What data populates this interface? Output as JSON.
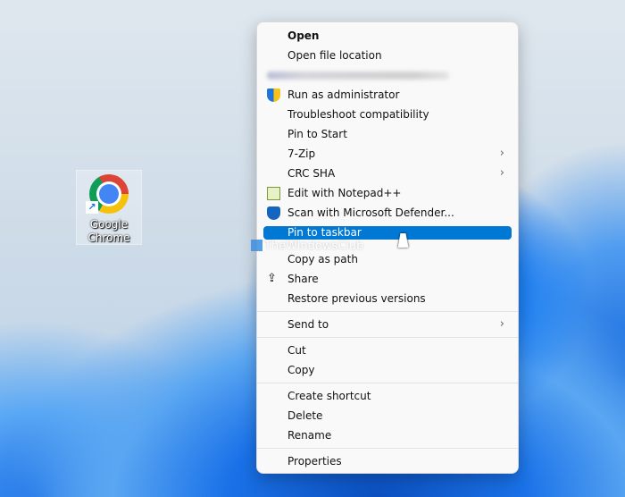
{
  "desktop": {
    "icon": {
      "label": "Google Chrome",
      "icon": "chrome-icon",
      "shortcut_overlay": "shortcut-arrow-icon"
    }
  },
  "menu": {
    "items": [
      {
        "label": "Open",
        "bold": true
      },
      {
        "label": "Open file location"
      },
      {
        "label": "",
        "blurred": true
      },
      {
        "label": "Run as administrator",
        "icon": "uac-shield-icon"
      },
      {
        "label": "Troubleshoot compatibility"
      },
      {
        "label": "Pin to Start"
      },
      {
        "label": "7-Zip",
        "submenu": true
      },
      {
        "label": "CRC SHA",
        "submenu": true
      },
      {
        "label": "Edit with Notepad++",
        "icon": "notepad-plus-plus-icon"
      },
      {
        "label": "Scan with Microsoft Defender...",
        "icon": "defender-shield-icon"
      },
      {
        "label": "Pin to taskbar",
        "highlighted": true
      },
      {
        "label": "Copy as path"
      },
      {
        "label": "Share",
        "icon": "share-icon"
      },
      {
        "label": "Restore previous versions"
      },
      {
        "label": "Send to",
        "submenu": true
      },
      {
        "label": "Cut"
      },
      {
        "label": "Copy"
      },
      {
        "label": "Create shortcut"
      },
      {
        "label": "Delete"
      },
      {
        "label": "Rename"
      },
      {
        "label": "Properties"
      }
    ],
    "submenu_arrow": "›",
    "highlight_color": "#0078d4"
  },
  "watermark": "TheWindowsClub"
}
